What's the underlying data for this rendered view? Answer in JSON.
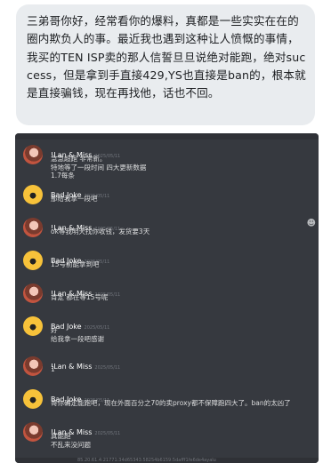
{
  "post": {
    "text": "三弟哥你好，经常看你的爆料，真都是一些实实在在的圈内欺负人的事。最近我也遇到这种让人愤慨的事情，我买的TEN ISP卖的那人信誓旦旦说绝对能跑，绝对success，但是拿到手直接429,YS也直接是ban的，根本就是直接骗钱，现在再找他，话也不回。"
  },
  "chat": {
    "messages": [
      {
        "author": "!Lan & Miss",
        "time": "2025/05/11",
        "lines": [
          "急急超跑 非常新。",
          "特地等了一段时间 四大更新数据",
          "1.7每条"
        ],
        "avatar": "lan"
      },
      {
        "author": "Bad Joke",
        "time": "2025/05/11",
        "lines": [
          "那给我拿一段吧"
        ],
        "avatar": "bad"
      },
      {
        "author": "!Lan & Miss",
        "time": "2025/05/11",
        "lines": [
          "ok等我明天找你收钱，发货要3天"
        ],
        "avatar": "lan"
      },
      {
        "author": "Bad Joke",
        "time": "2025/05/11",
        "lines": [
          "15号前能拿到吧"
        ],
        "avatar": "bad"
      },
      {
        "author": "!Lan & Miss",
        "time": "2025/05/11",
        "lines": [
          "肯定 都在等15号呢"
        ],
        "avatar": "lan"
      },
      {
        "author": "Bad Joke",
        "time": "2025/05/11",
        "lines": [
          "好",
          "给我拿一段吧感谢"
        ],
        "avatar": "bad"
      },
      {
        "author": "!Lan & Miss",
        "time": "2025/05/11",
        "lines": [
          "1"
        ],
        "avatar": "lan"
      },
      {
        "author": "Bad Joke",
        "time": "2025/05/11",
        "lines": [
          "哥你确定能跑吧，现在外面百分之70的卖proxy都不保障跑四大了。ban的太凶了"
        ],
        "avatar": "bad"
      },
      {
        "author": "!Lan & Miss",
        "time": "2025/05/11",
        "lines": [
          "真能跑",
          "不乱来没问题"
        ],
        "avatar": "lan"
      }
    ],
    "footer_text": "85.20.61.4:21771:34d65343:58254b6159:5dafff1fe6de4ayalu"
  }
}
